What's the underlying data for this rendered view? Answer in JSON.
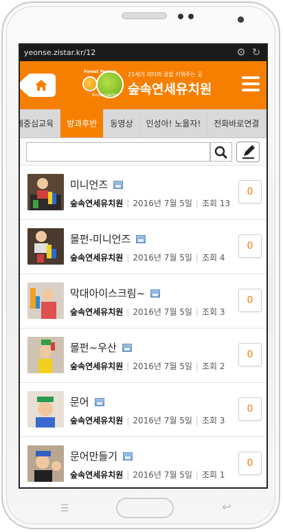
{
  "browser": {
    "url": "yeonse.zistar.kr/12"
  },
  "header": {
    "tagline": "21세기 리더의 꿈을 키워주는 곳",
    "name": "숲속연세유치원",
    "logo_en_top": "Forest Yeonse",
    "logo_en_bottom": "Kindergarten"
  },
  "tabs": [
    {
      "label": "세중심교육",
      "active": false
    },
    {
      "label": "방과후반",
      "active": true
    },
    {
      "label": "동영상",
      "active": false
    },
    {
      "label": "인성아! 노올자!",
      "active": false
    },
    {
      "label": "전화바로연결",
      "active": false
    }
  ],
  "search": {
    "value": "",
    "placeholder": ""
  },
  "posts": [
    {
      "title": "미니언즈",
      "author": "숲속연세유치원",
      "date": "2016년 7월 5일",
      "views": "조회 13",
      "comments": "0"
    },
    {
      "title": "몰펀-미니언즈",
      "author": "숲속연세유치원",
      "date": "2016년 7월 5일",
      "views": "조회 4",
      "comments": "0"
    },
    {
      "title": "막대아이스크림~",
      "author": "숲속연세유치원",
      "date": "2016년 7월 5일",
      "views": "조회 3",
      "comments": "0"
    },
    {
      "title": "몰펀~우산",
      "author": "숲속연세유치원",
      "date": "2016년 7월 5일",
      "views": "조회 2",
      "comments": "0"
    },
    {
      "title": "문어",
      "author": "숲속연세유치원",
      "date": "2016년 7월 5일",
      "views": "조회 3",
      "comments": "0"
    },
    {
      "title": "문어만들기",
      "author": "숲속연세유치원",
      "date": "2016년 7월 5일",
      "views": "조회 1",
      "comments": "0"
    }
  ],
  "colors": {
    "brand": "#f77f00",
    "tab_bg": "#d9d9d9",
    "count_text": "#f07a00"
  }
}
